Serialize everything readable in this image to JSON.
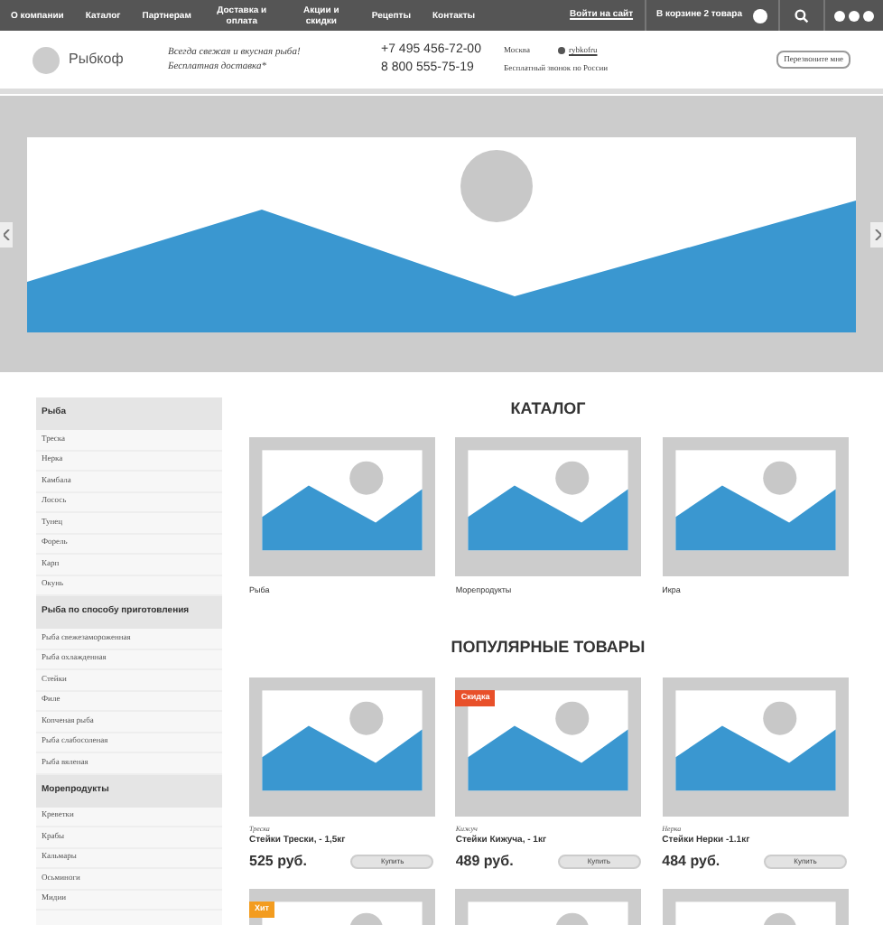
{
  "nav": {
    "items": [
      "О компании",
      "Каталог",
      "Партнерам",
      "Доставка и оплата",
      "Акции и скидки",
      "Рецепты",
      "Контакты"
    ],
    "login": "Войти на сайт",
    "cart": "В корзине 2 товара"
  },
  "header": {
    "logo": "Рыбкоф",
    "slogan": [
      "Всегда свежая и вкусная рыба!",
      "Бесплатная доставка*"
    ],
    "phones": [
      "+7 495 456-72-00",
      "8 800 555-75-19"
    ],
    "city": "Москва",
    "skype": "rybkofru",
    "free_call": "Бесплатный звонок по России",
    "callback": "Перезвоните мне"
  },
  "sidebar": [
    {
      "title": "Рыба",
      "items": [
        "Треска",
        "Нерка",
        "Камбала",
        "Лосось",
        "Тунец",
        "Форель",
        "Карп",
        "Окунь"
      ]
    },
    {
      "title": "Рыба по способу приготовления",
      "items": [
        "Рыба свежезамороженная",
        "Рыба охлажденная",
        "Стейки",
        "Филе",
        "Копченая рыба",
        "Рыба слабосоленая",
        "Рыба вяленая"
      ]
    },
    {
      "title": "Морепродукты",
      "items": [
        "Креветки",
        "Крабы",
        "Кальмары",
        "Осьминоги",
        "Мидии"
      ]
    }
  ],
  "catalog": {
    "title": "КАТАЛОГ",
    "items": [
      "Рыба",
      "Морепродукты",
      "Икра"
    ]
  },
  "popular": {
    "title": "ПОПУЛЯРНЫЕ ТОВАРЫ",
    "products": [
      {
        "kind": "product",
        "category": "Треска",
        "name": "Стейки Трески, - 1,5кг",
        "price": "525 руб.",
        "buy": "Купить"
      },
      {
        "kind": "product",
        "badge": {
          "text": "Скидка",
          "color": "#e8502a"
        },
        "category": "Кижуч",
        "name": "Стейки Кижуча, - 1кг",
        "price": "489 руб.",
        "buy": "Купить"
      },
      {
        "kind": "product",
        "category": "Нерка",
        "name": "Стейки Нерки -1.1кг",
        "price": "484 руб.",
        "buy": "Купить"
      },
      {
        "kind": "product",
        "badge": {
          "text": "Хит",
          "color": "#f39c1f"
        }
      },
      {
        "kind": "product"
      },
      {
        "kind": "product"
      }
    ]
  }
}
